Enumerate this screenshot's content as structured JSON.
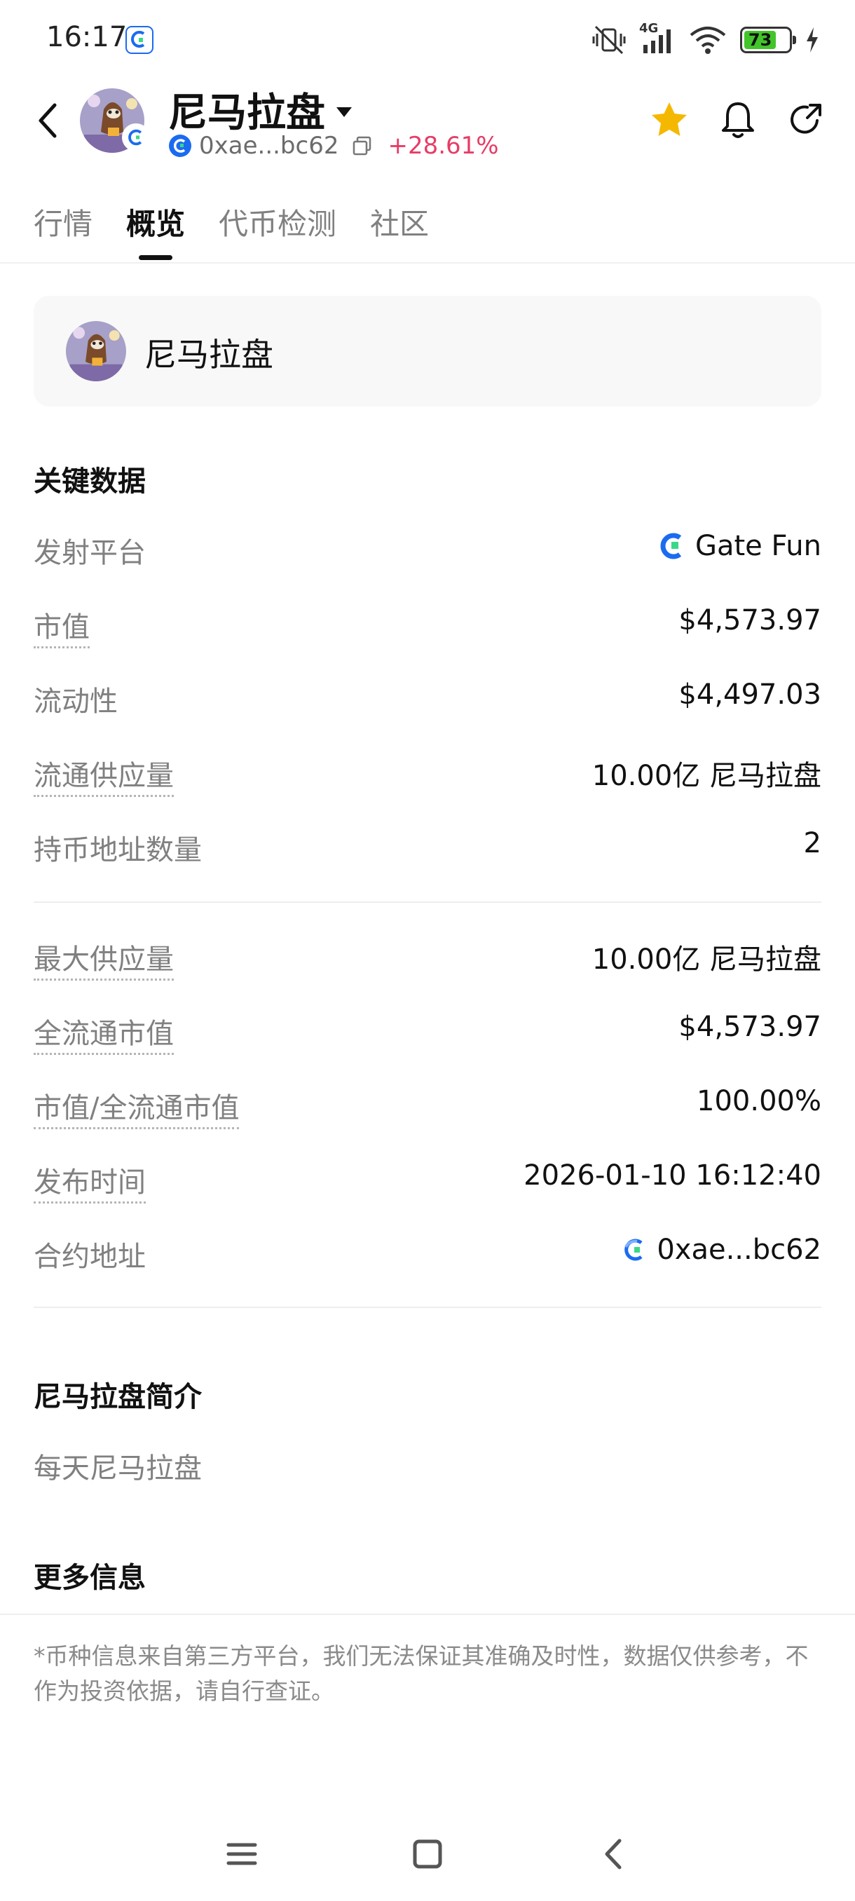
{
  "status_bar": {
    "time": "16:17",
    "network": "4G",
    "battery": "73"
  },
  "header": {
    "title": "尼马拉盘",
    "address": "0xae...bc62",
    "change": "+28.61%"
  },
  "tabs": [
    {
      "label": "行情",
      "active": false
    },
    {
      "label": "概览",
      "active": true
    },
    {
      "label": "代币检测",
      "active": false
    },
    {
      "label": "社区",
      "active": false
    }
  ],
  "token_card": {
    "name": "尼马拉盘"
  },
  "key_data": {
    "title": "关键数据",
    "rows": [
      {
        "label": "发射平台",
        "value": "Gate Fun"
      },
      {
        "label": "市值",
        "value": "$4,573.97"
      },
      {
        "label": "流动性",
        "value": "$4,497.03"
      },
      {
        "label": "流通供应量",
        "value": "10.00亿 尼马拉盘"
      },
      {
        "label": "持币地址数量",
        "value": "2"
      },
      {
        "label": "最大供应量",
        "value": "10.00亿 尼马拉盘"
      },
      {
        "label": "全流通市值",
        "value": "$4,573.97"
      },
      {
        "label": "市值/全流通市值",
        "value": "100.00%"
      },
      {
        "label": "发布时间",
        "value": "2026-01-10 16:12:40"
      },
      {
        "label": "合约地址",
        "value": "0xae...bc62"
      }
    ]
  },
  "intro": {
    "title": "尼马拉盘简介",
    "text": "每天尼马拉盘"
  },
  "more_info": {
    "title": "更多信息"
  },
  "disclaimer": "*币种信息来自第三方平台，我们无法保证其准确及时性，数据仅供参考，不作为投资依据，请自行查证。",
  "colors": {
    "accent_positive": "#e63d67",
    "favorite_star": "#f5b800",
    "brand_blue": "#1b6bf0",
    "brand_green": "#3ad88a"
  },
  "icons": [
    "back-icon",
    "caret-down-icon",
    "chain-icon",
    "copy-icon",
    "star-icon",
    "bell-icon",
    "share-icon",
    "gate-fun-icon",
    "menu-icon",
    "home-icon",
    "nav-back-icon"
  ]
}
